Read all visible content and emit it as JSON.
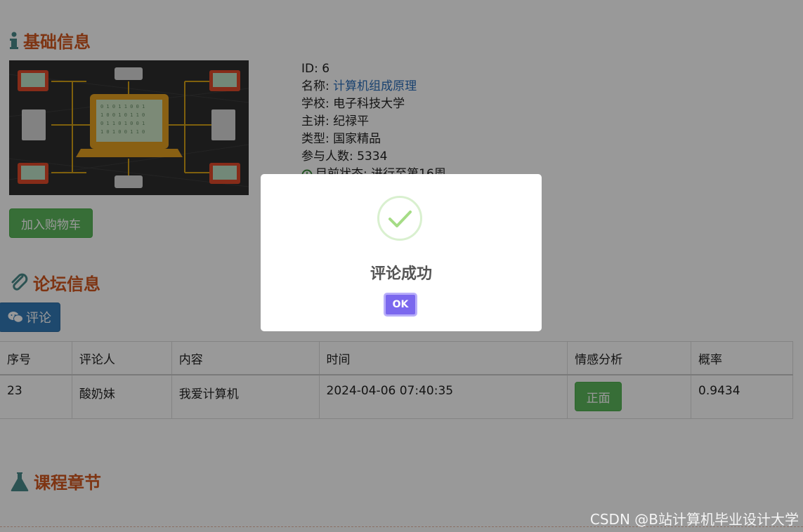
{
  "sections": {
    "basic_info": "基础信息",
    "forum_info": "论坛信息",
    "chapters": "课程章节"
  },
  "course": {
    "id": "ID: 6",
    "name_label": "名称: ",
    "name_value": "计算机组成原理",
    "school": "学校: 电子科技大学",
    "lecturer": "主讲: 纪禄平",
    "type": "类型: 国家精品",
    "participants": "参与人数: 5334",
    "status": "目前状态: 进行至第16周"
  },
  "buttons": {
    "add_to_cart": "加入购物车",
    "comment": "评论"
  },
  "table": {
    "headers": [
      "序号",
      "评论人",
      "内容",
      "时间",
      "情感分析",
      "概率"
    ],
    "rows": [
      {
        "index": "23",
        "user": "酸奶妹",
        "content": "我爱计算机",
        "time": "2024-04-06 07:40:35",
        "sentiment": "正面",
        "probability": "0.9434"
      }
    ]
  },
  "modal": {
    "title": "评论成功",
    "ok_label": "OK"
  },
  "watermark": "CSDN @B站计算机毕业设计大学",
  "colors": {
    "section_title": "#d2581f",
    "link": "#2a6ebb",
    "green_button": "#5cb85c",
    "blue_button": "#337ab7",
    "ok_button": "#7b68ee",
    "success_check": "#a5dc86"
  }
}
